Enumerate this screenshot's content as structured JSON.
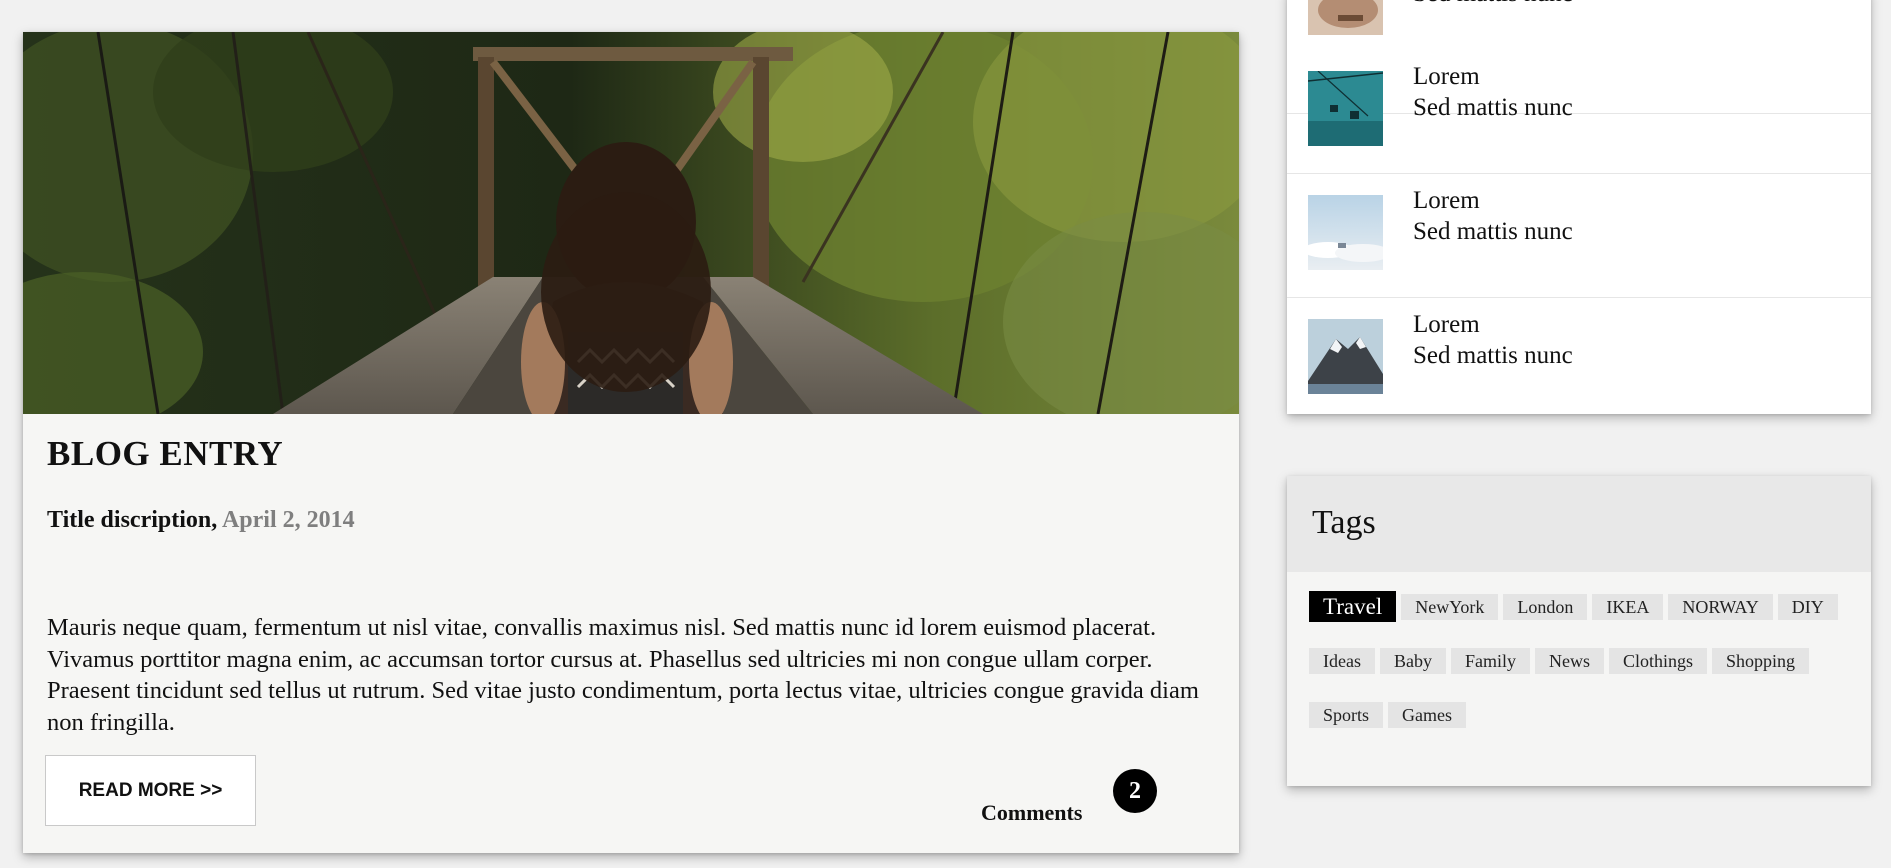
{
  "blog": {
    "title": "BLOG ENTRY",
    "subtitle_label": "Title discription,",
    "date": "April 2, 2014",
    "body": "Mauris neque quam, fermentum ut nisl vitae, convallis maximus nisl. Sed mattis nunc id lorem euismod placerat. Vivamus porttitor magna enim, ac accumsan tortor cursus at. Phasellus sed ultricies mi non congue ullam corper. Praesent tincidunt sed tellus ut rutrum. Sed vitae justo condimentum, porta lectus vitae, ultricies congue gravida diam non fringilla.",
    "read_more": "READ MORE >>",
    "comments_label": "Comments",
    "comments_count": "2"
  },
  "recent_posts": [
    {
      "title": "",
      "subtitle": "Sed mattis nunc",
      "thumb": "hands-photo"
    },
    {
      "title": "Lorem",
      "subtitle": "Sed mattis nunc",
      "thumb": "cable-car-photo"
    },
    {
      "title": "Lorem",
      "subtitle": "Sed mattis nunc",
      "thumb": "clouds-photo"
    },
    {
      "title": "Lorem",
      "subtitle": "Sed mattis nunc",
      "thumb": "mountain-photo"
    }
  ],
  "tags": {
    "title": "Tags",
    "rows": [
      [
        "Travel",
        "NewYork",
        "London",
        "IKEA",
        "NORWAY",
        "DIY"
      ],
      [
        "Ideas",
        "Baby",
        "Family",
        "News",
        "Clothings",
        "Shopping"
      ],
      [
        "Sports",
        "Games"
      ]
    ],
    "active": "Travel"
  }
}
